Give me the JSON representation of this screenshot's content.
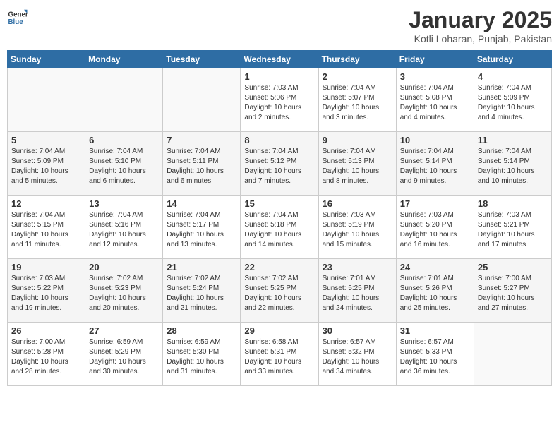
{
  "logo": {
    "general": "General",
    "blue": "Blue"
  },
  "title": "January 2025",
  "subtitle": "Kotli Loharan, Punjab, Pakistan",
  "weekdays": [
    "Sunday",
    "Monday",
    "Tuesday",
    "Wednesday",
    "Thursday",
    "Friday",
    "Saturday"
  ],
  "weeks": [
    [
      {
        "day": "",
        "info": ""
      },
      {
        "day": "",
        "info": ""
      },
      {
        "day": "",
        "info": ""
      },
      {
        "day": "1",
        "info": "Sunrise: 7:03 AM\nSunset: 5:06 PM\nDaylight: 10 hours\nand 2 minutes."
      },
      {
        "day": "2",
        "info": "Sunrise: 7:04 AM\nSunset: 5:07 PM\nDaylight: 10 hours\nand 3 minutes."
      },
      {
        "day": "3",
        "info": "Sunrise: 7:04 AM\nSunset: 5:08 PM\nDaylight: 10 hours\nand 4 minutes."
      },
      {
        "day": "4",
        "info": "Sunrise: 7:04 AM\nSunset: 5:09 PM\nDaylight: 10 hours\nand 4 minutes."
      }
    ],
    [
      {
        "day": "5",
        "info": "Sunrise: 7:04 AM\nSunset: 5:09 PM\nDaylight: 10 hours\nand 5 minutes."
      },
      {
        "day": "6",
        "info": "Sunrise: 7:04 AM\nSunset: 5:10 PM\nDaylight: 10 hours\nand 6 minutes."
      },
      {
        "day": "7",
        "info": "Sunrise: 7:04 AM\nSunset: 5:11 PM\nDaylight: 10 hours\nand 6 minutes."
      },
      {
        "day": "8",
        "info": "Sunrise: 7:04 AM\nSunset: 5:12 PM\nDaylight: 10 hours\nand 7 minutes."
      },
      {
        "day": "9",
        "info": "Sunrise: 7:04 AM\nSunset: 5:13 PM\nDaylight: 10 hours\nand 8 minutes."
      },
      {
        "day": "10",
        "info": "Sunrise: 7:04 AM\nSunset: 5:14 PM\nDaylight: 10 hours\nand 9 minutes."
      },
      {
        "day": "11",
        "info": "Sunrise: 7:04 AM\nSunset: 5:14 PM\nDaylight: 10 hours\nand 10 minutes."
      }
    ],
    [
      {
        "day": "12",
        "info": "Sunrise: 7:04 AM\nSunset: 5:15 PM\nDaylight: 10 hours\nand 11 minutes."
      },
      {
        "day": "13",
        "info": "Sunrise: 7:04 AM\nSunset: 5:16 PM\nDaylight: 10 hours\nand 12 minutes."
      },
      {
        "day": "14",
        "info": "Sunrise: 7:04 AM\nSunset: 5:17 PM\nDaylight: 10 hours\nand 13 minutes."
      },
      {
        "day": "15",
        "info": "Sunrise: 7:04 AM\nSunset: 5:18 PM\nDaylight: 10 hours\nand 14 minutes."
      },
      {
        "day": "16",
        "info": "Sunrise: 7:03 AM\nSunset: 5:19 PM\nDaylight: 10 hours\nand 15 minutes."
      },
      {
        "day": "17",
        "info": "Sunrise: 7:03 AM\nSunset: 5:20 PM\nDaylight: 10 hours\nand 16 minutes."
      },
      {
        "day": "18",
        "info": "Sunrise: 7:03 AM\nSunset: 5:21 PM\nDaylight: 10 hours\nand 17 minutes."
      }
    ],
    [
      {
        "day": "19",
        "info": "Sunrise: 7:03 AM\nSunset: 5:22 PM\nDaylight: 10 hours\nand 19 minutes."
      },
      {
        "day": "20",
        "info": "Sunrise: 7:02 AM\nSunset: 5:23 PM\nDaylight: 10 hours\nand 20 minutes."
      },
      {
        "day": "21",
        "info": "Sunrise: 7:02 AM\nSunset: 5:24 PM\nDaylight: 10 hours\nand 21 minutes."
      },
      {
        "day": "22",
        "info": "Sunrise: 7:02 AM\nSunset: 5:25 PM\nDaylight: 10 hours\nand 22 minutes."
      },
      {
        "day": "23",
        "info": "Sunrise: 7:01 AM\nSunset: 5:25 PM\nDaylight: 10 hours\nand 24 minutes."
      },
      {
        "day": "24",
        "info": "Sunrise: 7:01 AM\nSunset: 5:26 PM\nDaylight: 10 hours\nand 25 minutes."
      },
      {
        "day": "25",
        "info": "Sunrise: 7:00 AM\nSunset: 5:27 PM\nDaylight: 10 hours\nand 27 minutes."
      }
    ],
    [
      {
        "day": "26",
        "info": "Sunrise: 7:00 AM\nSunset: 5:28 PM\nDaylight: 10 hours\nand 28 minutes."
      },
      {
        "day": "27",
        "info": "Sunrise: 6:59 AM\nSunset: 5:29 PM\nDaylight: 10 hours\nand 30 minutes."
      },
      {
        "day": "28",
        "info": "Sunrise: 6:59 AM\nSunset: 5:30 PM\nDaylight: 10 hours\nand 31 minutes."
      },
      {
        "day": "29",
        "info": "Sunrise: 6:58 AM\nSunset: 5:31 PM\nDaylight: 10 hours\nand 33 minutes."
      },
      {
        "day": "30",
        "info": "Sunrise: 6:57 AM\nSunset: 5:32 PM\nDaylight: 10 hours\nand 34 minutes."
      },
      {
        "day": "31",
        "info": "Sunrise: 6:57 AM\nSunset: 5:33 PM\nDaylight: 10 hours\nand 36 minutes."
      },
      {
        "day": "",
        "info": ""
      }
    ]
  ]
}
